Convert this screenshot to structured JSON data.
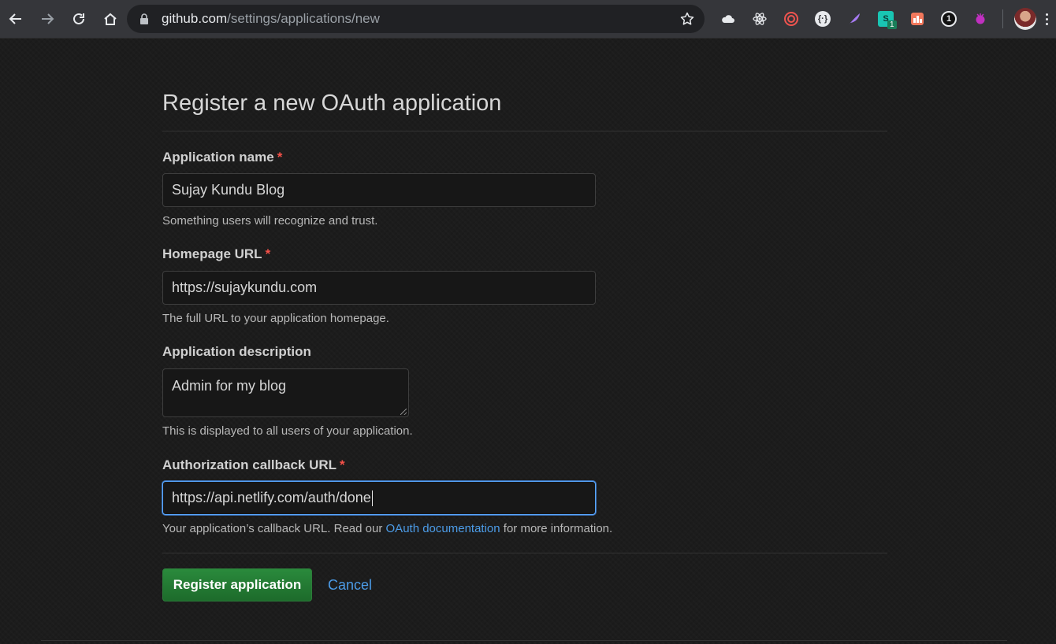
{
  "browser": {
    "url_host": "github.com",
    "url_path": "/settings/applications/new",
    "extensions": [
      {
        "icon": "cloud-icon",
        "color": "#e8eaed"
      },
      {
        "icon": "react-devtools-icon",
        "color": "#e8eaed"
      },
      {
        "icon": "spiral-icon",
        "color": "#f0544f"
      },
      {
        "icon": "braces-icon",
        "color": "#e8eaed"
      },
      {
        "icon": "feather-icon",
        "color": "#a77bf3"
      },
      {
        "icon": "s-extension-icon",
        "color": "#19c5b3",
        "badge": "1"
      },
      {
        "icon": "grid-extension-icon",
        "color": "#f2785c"
      },
      {
        "icon": "onepassword-icon",
        "color": "#e8eaed"
      },
      {
        "icon": "bug-extension-icon",
        "color": "#c030c0"
      }
    ]
  },
  "page": {
    "title": "Register a new OAuth application",
    "accent_color": "#4c9ce8",
    "required_color": "#f85149"
  },
  "form": {
    "app_name": {
      "label": "Application name",
      "required_mark": "*",
      "value": "Sujay Kundu Blog",
      "note": "Something users will recognize and trust."
    },
    "homepage": {
      "label": "Homepage URL",
      "required_mark": "*",
      "value": "https://sujaykundu.com",
      "note": "The full URL to your application homepage."
    },
    "description": {
      "label": "Application description",
      "value": "Admin for my blog",
      "note": "This is displayed to all users of your application."
    },
    "callback": {
      "label": "Authorization callback URL",
      "required_mark": "*",
      "value": "https://api.netlify.com/auth/done",
      "note_before": "Your application’s callback URL. Read our",
      "note_link": "OAuth documentation",
      "note_after": "for more information."
    }
  },
  "actions": {
    "submit_label": "Register application",
    "cancel_label": "Cancel"
  }
}
